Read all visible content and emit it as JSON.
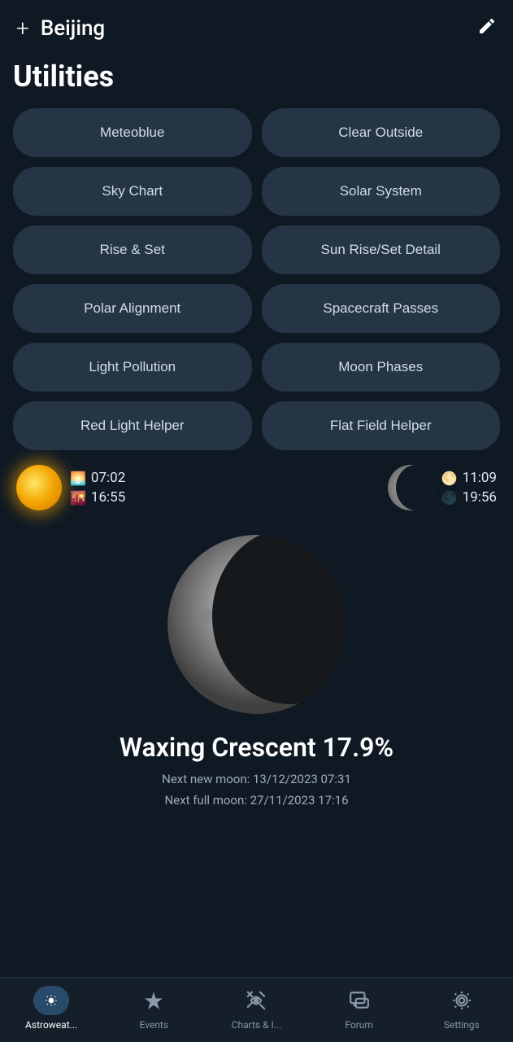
{
  "header": {
    "title": "Beijing",
    "plus_label": "+",
    "edit_icon": "edit-icon"
  },
  "utilities": {
    "heading": "Utilities",
    "buttons": [
      {
        "id": "meteoblue",
        "label": "Meteoblue"
      },
      {
        "id": "clear-outside",
        "label": "Clear Outside"
      },
      {
        "id": "sky-chart",
        "label": "Sky Chart"
      },
      {
        "id": "solar-system",
        "label": "Solar System"
      },
      {
        "id": "rise-set",
        "label": "Rise & Set"
      },
      {
        "id": "sun-rise-set-detail",
        "label": "Sun Rise/Set Detail"
      },
      {
        "id": "polar-alignment",
        "label": "Polar Alignment"
      },
      {
        "id": "spacecraft-passes",
        "label": "Spacecraft Passes"
      },
      {
        "id": "light-pollution",
        "label": "Light Pollution"
      },
      {
        "id": "moon-phases",
        "label": "Moon Phases"
      },
      {
        "id": "red-light-helper",
        "label": "Red Light Helper"
      },
      {
        "id": "flat-field-helper",
        "label": "Flat Field Helper"
      }
    ]
  },
  "sun": {
    "rise": "07:02",
    "set": "16:55"
  },
  "moon": {
    "rise": "11:09",
    "set": "19:56"
  },
  "moon_phase": {
    "name": "Waxing Crescent 17.9%",
    "next_new_moon_label": "Next new moon: 13/12/2023 07:31",
    "next_full_moon_label": "Next full moon: 27/11/2023 17:16"
  },
  "bottom_nav": {
    "items": [
      {
        "id": "astroweather",
        "label": "Astroweat...",
        "active": true
      },
      {
        "id": "events",
        "label": "Events",
        "active": false
      },
      {
        "id": "charts",
        "label": "Charts & I...",
        "active": false
      },
      {
        "id": "forum",
        "label": "Forum",
        "active": false
      },
      {
        "id": "settings",
        "label": "Settings",
        "active": false
      }
    ]
  }
}
